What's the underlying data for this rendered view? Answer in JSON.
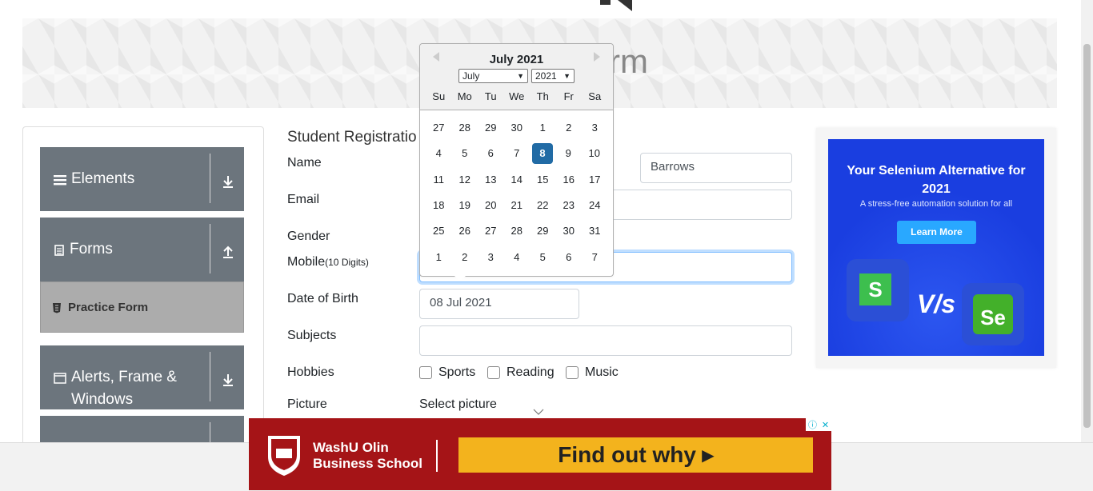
{
  "banner": {
    "title_fragment": "rm"
  },
  "sidebar": {
    "groups": [
      {
        "label": "Elements",
        "icon": "hamburger-icon",
        "arrow": "download-icon"
      },
      {
        "label": "Forms",
        "icon": "document-icon",
        "arrow": "upload-icon"
      },
      {
        "label": "Alerts, Frame & Windows",
        "icon": "window-icon",
        "arrow": "download-icon"
      }
    ],
    "active_item": {
      "label": "Practice Form",
      "icon": "html5-icon"
    }
  },
  "form": {
    "title": "Student Registratio",
    "name_label": "Name",
    "last_name_value": "Barrows",
    "email_label": "Email",
    "gender_label": "Gender",
    "mobile_label": "Mobile",
    "mobile_hint": "(10 Digits)",
    "dob_label": "Date of Birth",
    "dob_value": "08 Jul 2021",
    "subjects_label": "Subjects",
    "hobbies_label": "Hobbies",
    "hobbies": [
      "Sports",
      "Reading",
      "Music"
    ],
    "picture_label": "Picture",
    "picture_button": "Select picture"
  },
  "datepicker": {
    "month_title": "July 2021",
    "month_select": "July",
    "year_select": "2021",
    "weekdays": [
      "Su",
      "Mo",
      "Tu",
      "We",
      "Th",
      "Fr",
      "Sa"
    ],
    "weeks": [
      [
        "27",
        "28",
        "29",
        "30",
        "1",
        "2",
        "3"
      ],
      [
        "4",
        "5",
        "6",
        "7",
        "8",
        "9",
        "10"
      ],
      [
        "11",
        "12",
        "13",
        "14",
        "15",
        "16",
        "17"
      ],
      [
        "18",
        "19",
        "20",
        "21",
        "22",
        "23",
        "24"
      ],
      [
        "25",
        "26",
        "27",
        "28",
        "29",
        "30",
        "31"
      ],
      [
        "1",
        "2",
        "3",
        "4",
        "5",
        "6",
        "7"
      ]
    ],
    "selected_day": "8"
  },
  "right_ad": {
    "headline": "Your Selenium Alternative for 2021",
    "subline": "A stress-free automation solution for all",
    "button": "Learn More",
    "vs_text": "V/s",
    "logo_left": "S",
    "logo_right": "Se"
  },
  "bottom_ad": {
    "school_line1": "WashU Olin",
    "school_line2": "Business School",
    "cta": "Find out why ▸",
    "close": "✕",
    "info": "ⓘ"
  },
  "colors": {
    "selected_day": "#216ba5",
    "sidebar": "#6c757d",
    "ad_red": "#a51417",
    "ad_blue": "#1a3ee0",
    "cta_yellow": "#f3b31d"
  }
}
